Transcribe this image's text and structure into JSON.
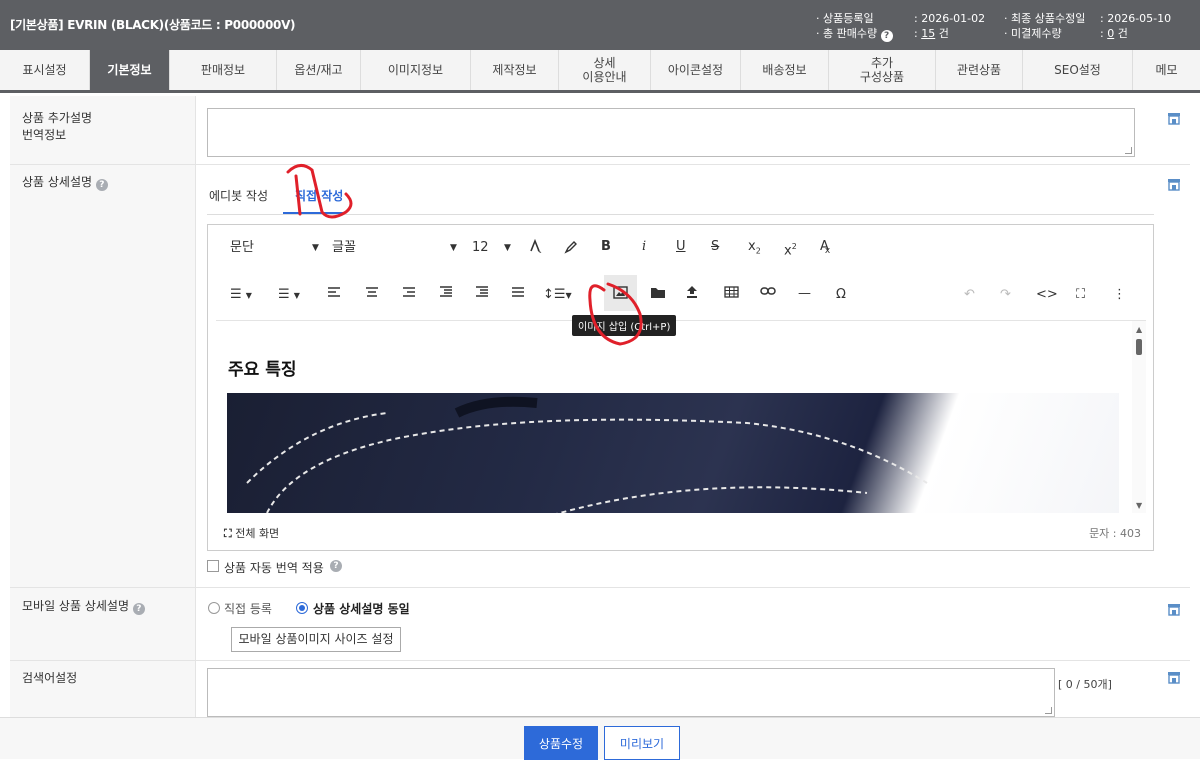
{
  "header": {
    "title": "[기본상품] EVRIN (BLACK)(상품코드 : P000000V)",
    "reg_date_label": "· 상품등록일",
    "reg_date_value": ": 2026-01-02",
    "total_sales_label": "· 총 판매수량",
    "total_sales_value": "15",
    "total_sales_unit": " 건",
    "last_modified_label": "· 최종 상품수정일",
    "last_modified_value": ": 2026-05-10",
    "unpaid_label": "· 미결제수량",
    "unpaid_value": "0",
    "unpaid_unit": " 건"
  },
  "tabs": [
    "표시설정",
    "기본정보",
    "판매정보",
    "옵션/재고",
    "이미지정보",
    "제작정보",
    "상세\n이용안내",
    "아이콘설정",
    "배송정보",
    "추가\n구성상품",
    "관련상품",
    "SEO설정",
    "메모"
  ],
  "rows": {
    "translation_label_1": "상품 추가설명",
    "translation_label_2": "번역정보",
    "detail_label": "상품 상세설명",
    "mobile_label": "모바일 상품 상세설명",
    "search_label": "검색어설정"
  },
  "editor": {
    "tab_editbot": "에디봇 작성",
    "tab_direct": "직접 작성",
    "paragraph": "문단",
    "font": "글꼴",
    "font_size": "12",
    "tooltip": "이미지 삽입 (Ctrl+P)",
    "content_heading": "주요 특징",
    "fullscreen": "전체 화면",
    "char_count": "문자 : 403",
    "auto_translate": "상품 자동 번역 적용"
  },
  "mobile": {
    "opt_direct": "직접 등록",
    "opt_same": "상품 상세설명 동일",
    "size_button": "모바일 상품이미지 사이즈 설정"
  },
  "search": {
    "counter": "[ 0 / 50개]"
  },
  "footer": {
    "save": "상품수정",
    "preview": "미리보기"
  },
  "colors": {
    "header_bg": "#5d5f63",
    "primary": "#2d6ad9",
    "annotation": "#e0202a"
  }
}
